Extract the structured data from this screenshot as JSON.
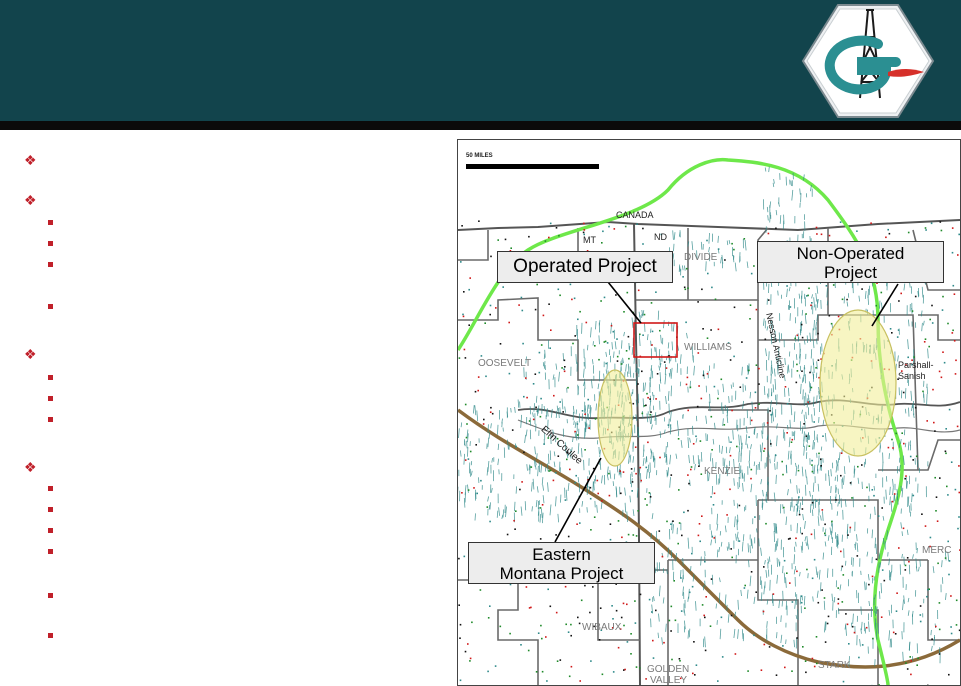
{
  "map": {
    "scale_label": "50 MILES",
    "region_labels": {
      "canada": "CANADA",
      "mt": "MT",
      "nd": "ND",
      "divide": "DIVIDE",
      "williams": "WILLIAMS",
      "roosevelt": "OOSEVELT",
      "mckenzie": "KENZIE",
      "wibaux": "WIBAUX",
      "golden": "GOLDEN",
      "valley": "VALLEY",
      "stark": "STARK",
      "mercer": "MERC",
      "parshall": "Parshall-",
      "sanish": "Sanish",
      "nesson": "Nesson Anticline",
      "elm": "Elm Coulee"
    },
    "callouts": {
      "operated": "Operated Project",
      "non_operated_line1": "Non-Operated",
      "non_operated_line2": "Project",
      "eastern_line1": "Eastern",
      "eastern_line2": "Montana Project"
    }
  },
  "colors": {
    "header_bg": "#12444c",
    "header_bar": "#0b0b0b",
    "bullet_red": "#c0202a",
    "boundary_green": "#6ee84a",
    "river_brown": "#8b6a3a",
    "highlight_yellow": "#f2ef9a",
    "project_red": "#d01818",
    "wells_teal": "#2f8a8a"
  },
  "icons": [
    "company-logo-icon",
    "diamond-bullet-icon",
    "square-bullet-icon"
  ]
}
